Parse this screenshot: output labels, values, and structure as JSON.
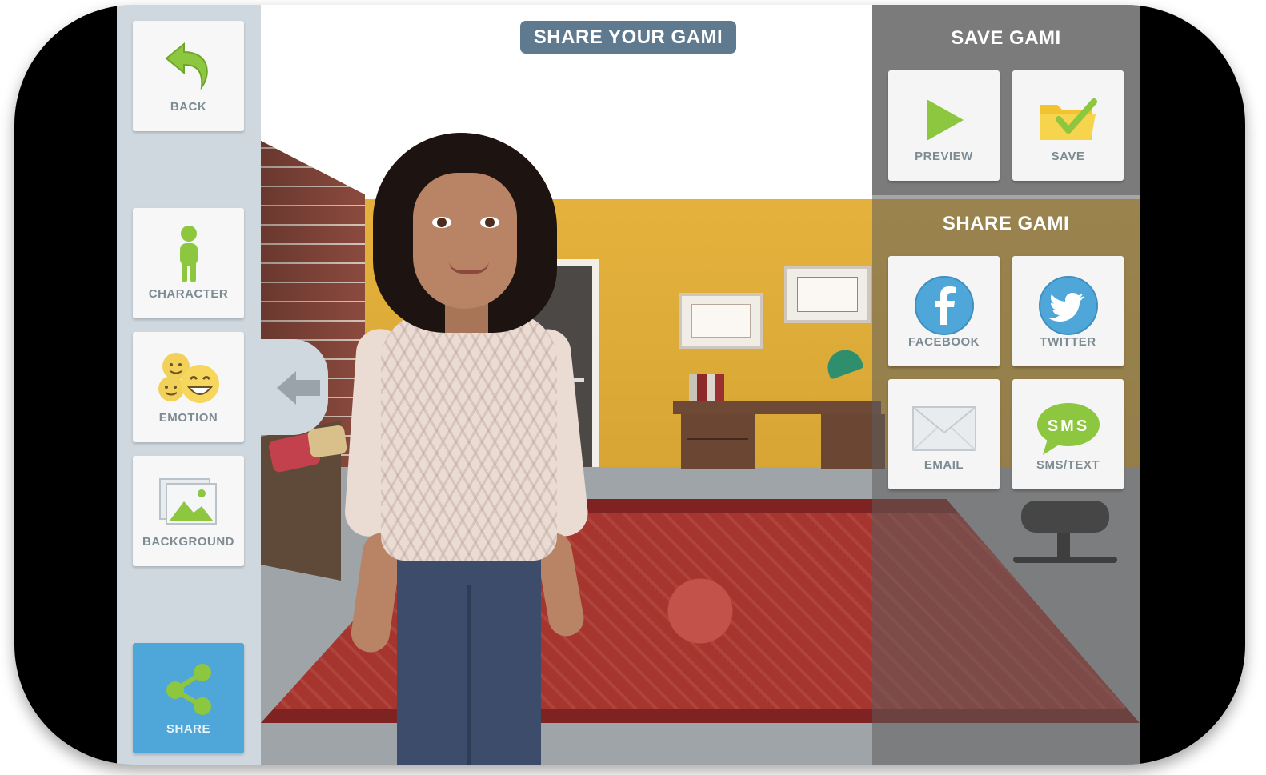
{
  "header": {
    "title": "SHARE YOUR GAMI"
  },
  "left_toolbar": {
    "back_label": "BACK",
    "character_label": "CHARACTER",
    "emotion_label": "EMOTION",
    "background_label": "BACKGROUND",
    "share_label": "SHARE"
  },
  "right_panel": {
    "save_section_title": "SAVE GAMI",
    "preview_label": "PREVIEW",
    "save_label": "SAVE",
    "share_section_title": "SHARE GAMI",
    "facebook_label": "FACEBOOK",
    "twitter_label": "TWITTER",
    "email_label": "EMAIL",
    "sms_label": "SMS/TEXT",
    "sms_icon_text": "SMS"
  },
  "icons": {
    "back": "back-arrow-icon",
    "character": "person-icon",
    "emotion": "smiley-faces-icon",
    "background": "picture-icon",
    "share": "share-icon",
    "collapse": "left-arrow-icon",
    "preview": "play-icon",
    "save": "folder-check-icon",
    "facebook": "facebook-icon",
    "twitter": "twitter-icon",
    "email": "envelope-icon",
    "sms": "sms-bubble-icon"
  },
  "colors": {
    "accent_green": "#8dc63f",
    "share_active": "#4fa6d8",
    "title_badge": "#5f7a8f",
    "social_blue": "#4fa6d8",
    "label_gray": "#7d8b93"
  }
}
